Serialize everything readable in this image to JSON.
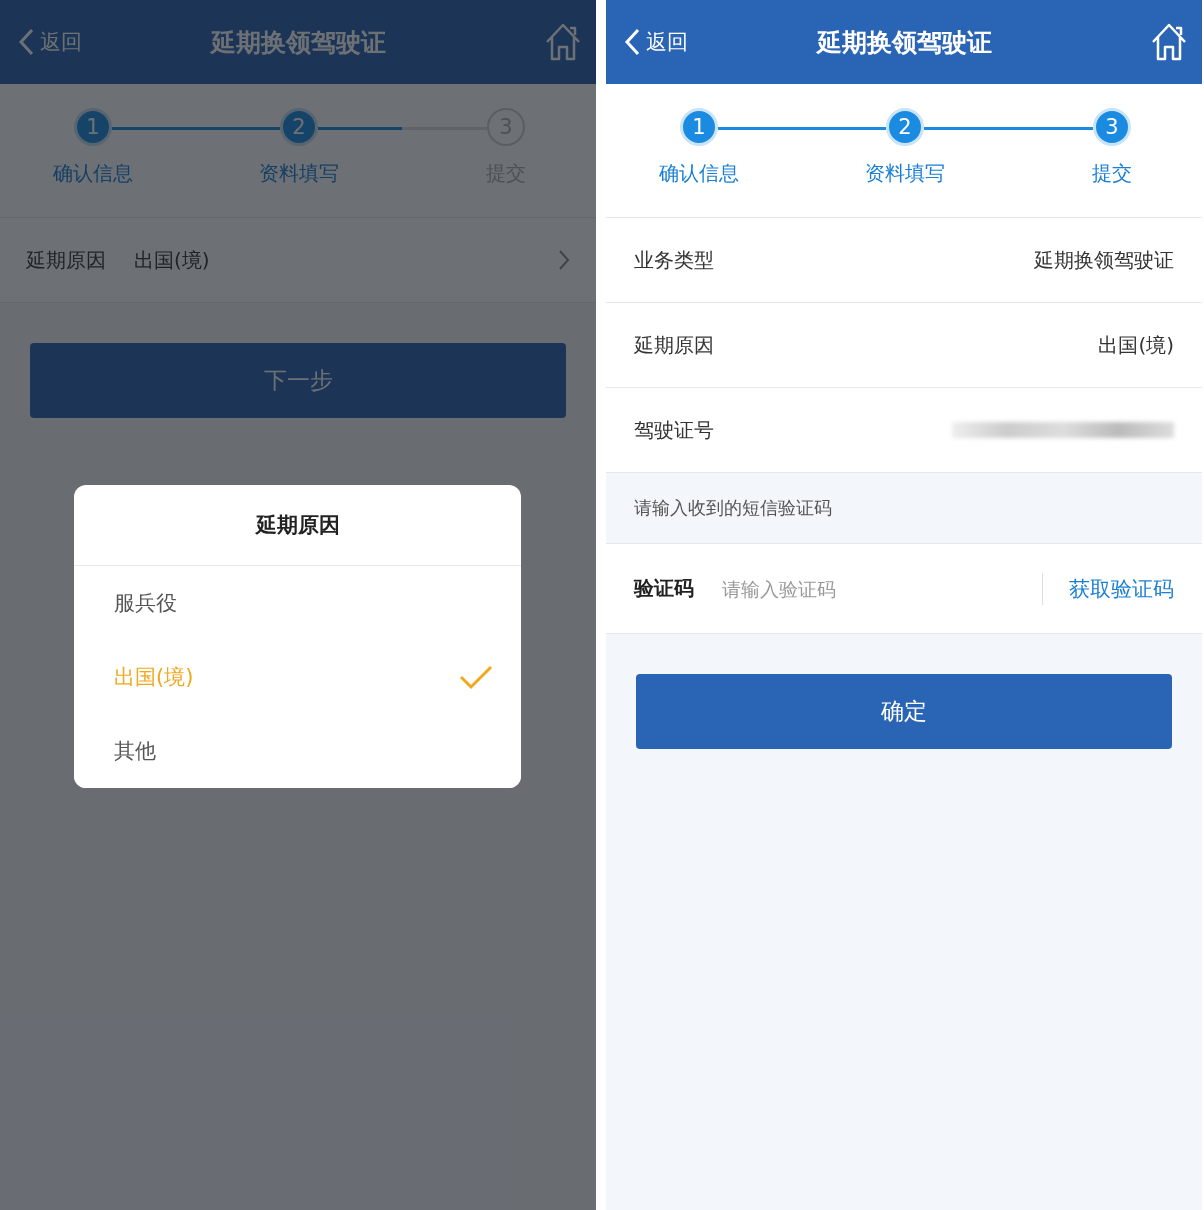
{
  "screens": [
    {
      "kind": "picker",
      "dimmed": true,
      "header": {
        "back": "返回",
        "title": "延期换领驾驶证"
      },
      "steps": [
        {
          "number": "1",
          "label": "确认信息",
          "done": true
        },
        {
          "number": "2",
          "label": "资料填写",
          "done": true
        },
        {
          "number": "3",
          "label": "提交",
          "done": false
        }
      ],
      "reason_row": {
        "label": "延期原因",
        "value": "出国(境)"
      },
      "next_button": "下一步",
      "dialog": {
        "title": "延期原因",
        "options": [
          {
            "label": "服兵役",
            "selected": false
          },
          {
            "label": "出国(境)",
            "selected": true
          },
          {
            "label": "其他",
            "selected": false
          }
        ]
      }
    },
    {
      "kind": "confirm",
      "dimmed": false,
      "header": {
        "back": "返回",
        "title": "延期换领驾驶证"
      },
      "steps": [
        {
          "number": "1",
          "label": "确认信息",
          "done": true
        },
        {
          "number": "2",
          "label": "资料填写",
          "done": true
        },
        {
          "number": "3",
          "label": "提交",
          "done": true
        }
      ],
      "rows": [
        {
          "kind": "text",
          "label": "业务类型",
          "value": "延期换领驾驶证"
        },
        {
          "kind": "text",
          "label": "延期原因",
          "value": "出国(境)"
        },
        {
          "kind": "redacted",
          "label": "驾驶证号"
        }
      ],
      "sms_hint": "请输入收到的短信验证码",
      "code_field": {
        "label": "验证码",
        "placeholder": "请输入验证码",
        "action": "获取验证码"
      },
      "confirm_button": "确定"
    }
  ]
}
